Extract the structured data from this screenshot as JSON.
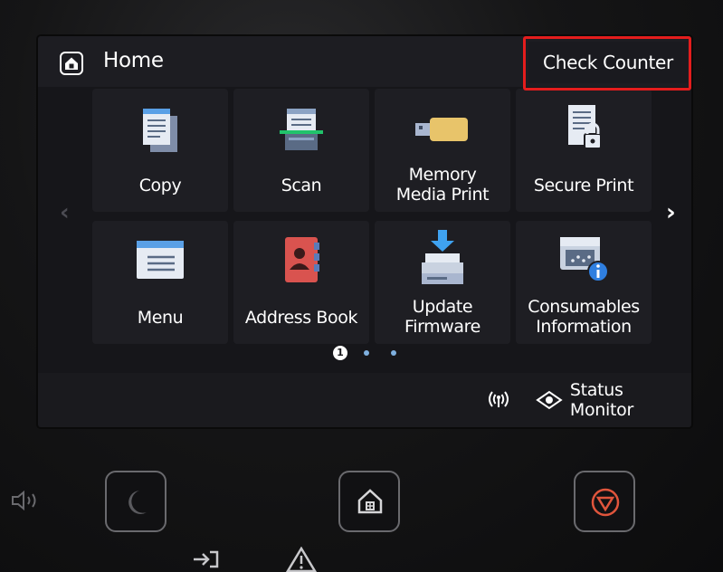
{
  "header": {
    "title": "Home",
    "check_counter_label": "Check Counter"
  },
  "tiles": [
    {
      "label": "Copy",
      "icon": "copy-icon"
    },
    {
      "label": "Scan",
      "icon": "scan-icon"
    },
    {
      "label": "Memory\nMedia Print",
      "icon": "usb-memory-icon"
    },
    {
      "label": "Secure Print",
      "icon": "secure-print-icon"
    },
    {
      "label": "Menu",
      "icon": "menu-icon"
    },
    {
      "label": "Address Book",
      "icon": "address-book-icon"
    },
    {
      "label": "Update\nFirmware",
      "icon": "update-firmware-icon"
    },
    {
      "label": "Consumables\nInformation",
      "icon": "consumables-info-icon"
    }
  ],
  "pagination": {
    "current": "1",
    "total": 3
  },
  "footer": {
    "status_monitor_label": "Status Monitor",
    "wireless_icon": "wireless-icon"
  },
  "colors": {
    "highlight": "#e41d1d",
    "stop_button": "#e0553c"
  }
}
